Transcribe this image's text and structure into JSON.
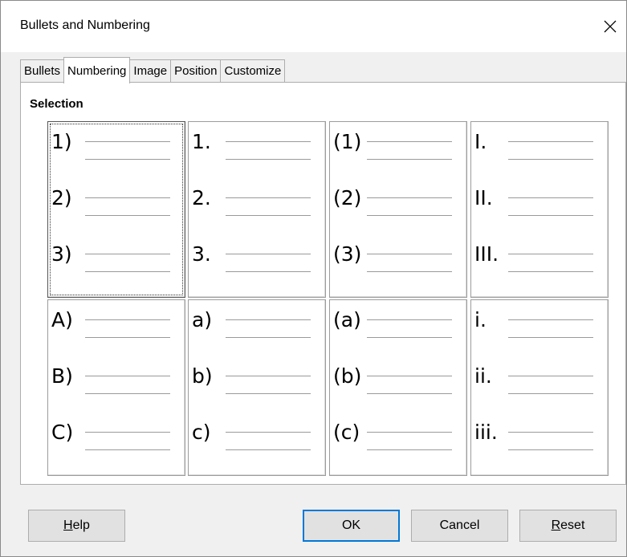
{
  "dialog": {
    "title": "Bullets and Numbering"
  },
  "tabs": [
    {
      "label": "Bullets",
      "active": false
    },
    {
      "label": "Numbering",
      "active": true
    },
    {
      "label": "Image",
      "active": false
    },
    {
      "label": "Position",
      "active": false
    },
    {
      "label": "Customize",
      "active": false
    }
  ],
  "selection": {
    "label": "Selection",
    "presets": [
      {
        "items": [
          "1)",
          "2)",
          "3)"
        ],
        "selected": true
      },
      {
        "items": [
          "1.",
          "2.",
          "3."
        ],
        "selected": false
      },
      {
        "items": [
          "(1)",
          "(2)",
          "(3)"
        ],
        "selected": false
      },
      {
        "items": [
          "I.",
          "II.",
          "III."
        ],
        "selected": false
      },
      {
        "items": [
          "A)",
          "B)",
          "C)"
        ],
        "selected": false
      },
      {
        "items": [
          "a)",
          "b)",
          "c)"
        ],
        "selected": false
      },
      {
        "items": [
          "(a)",
          "(b)",
          "(c)"
        ],
        "selected": false
      },
      {
        "items": [
          "i.",
          "ii.",
          "iii."
        ],
        "selected": false
      }
    ]
  },
  "buttons": {
    "help": {
      "mnemonic": "H",
      "rest": "elp"
    },
    "ok": "OK",
    "cancel": "Cancel",
    "reset": {
      "mnemonic": "R",
      "rest": "eset"
    }
  },
  "icons": {
    "close": "close-icon"
  },
  "colors": {
    "default_button_border": "#0078d7",
    "panel_bg": "#ffffff",
    "dialog_bg": "#f0f0f0"
  }
}
